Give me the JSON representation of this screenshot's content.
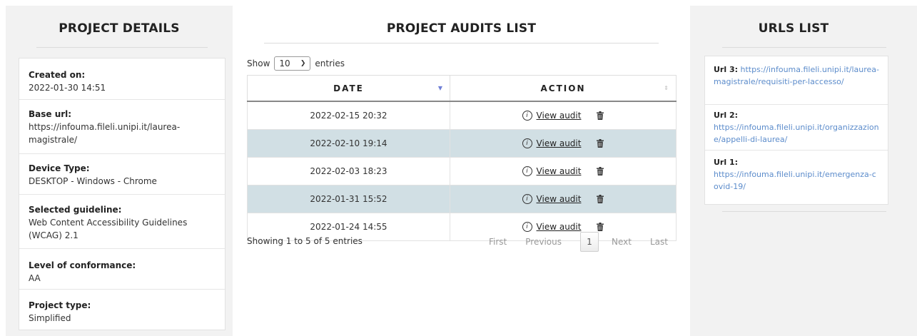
{
  "left": {
    "title": "PROJECT DETAILS",
    "created": {
      "label": "Created on:",
      "value": "2022-01-30 14:51"
    },
    "base_url": {
      "label": "Base url:",
      "value": "https://infouma.fileli.unipi.it/laurea-magistrale/"
    },
    "device": {
      "label": "Device Type:",
      "value": "DESKTOP - Windows - Chrome"
    },
    "guideline": {
      "label": "Selected guideline:",
      "value": "Web Content Accessibility Guidelines (WCAG) 2.1"
    },
    "level": {
      "label": "Level of conformance:",
      "value": "AA"
    },
    "type": {
      "label": "Project type:",
      "value": "Simplified"
    }
  },
  "middle": {
    "title": "PROJECT AUDITS LIST",
    "show_label": "Show",
    "entries_value": "10",
    "entries_label": "entries",
    "columns": {
      "date": "DATE",
      "action": "ACTION"
    },
    "view_label": "View audit",
    "rows": [
      {
        "date": "2022-02-15 20:32"
      },
      {
        "date": "2022-02-10 19:14"
      },
      {
        "date": "2022-02-03 18:23"
      },
      {
        "date": "2022-01-31 15:52"
      },
      {
        "date": "2022-01-24 14:55"
      }
    ],
    "info": "Showing 1 to 5 of 5 entries",
    "pager": {
      "first": "First",
      "previous": "Previous",
      "page": "1",
      "next": "Next",
      "last": "Last"
    }
  },
  "right": {
    "title": "URLS LIST",
    "urls": [
      {
        "label": "Url 3:",
        "value": "https://infouma.fileli.unipi.it/laurea-magistrale/requisiti-per-laccesso/"
      },
      {
        "label": "Url 2:",
        "value": "https://infouma.fileli.unipi.it/organizzazione/appelli-di-laurea/"
      },
      {
        "label": "Url 1:",
        "value": "https://infouma.fileli.unipi.it/emergenza-covid-19/"
      }
    ]
  },
  "colors": {
    "panel_bg": "#f2f2f2",
    "row_shade": "#d1dfe4",
    "link": "#5c8ccb",
    "sort_active": "#6f7fd6"
  }
}
